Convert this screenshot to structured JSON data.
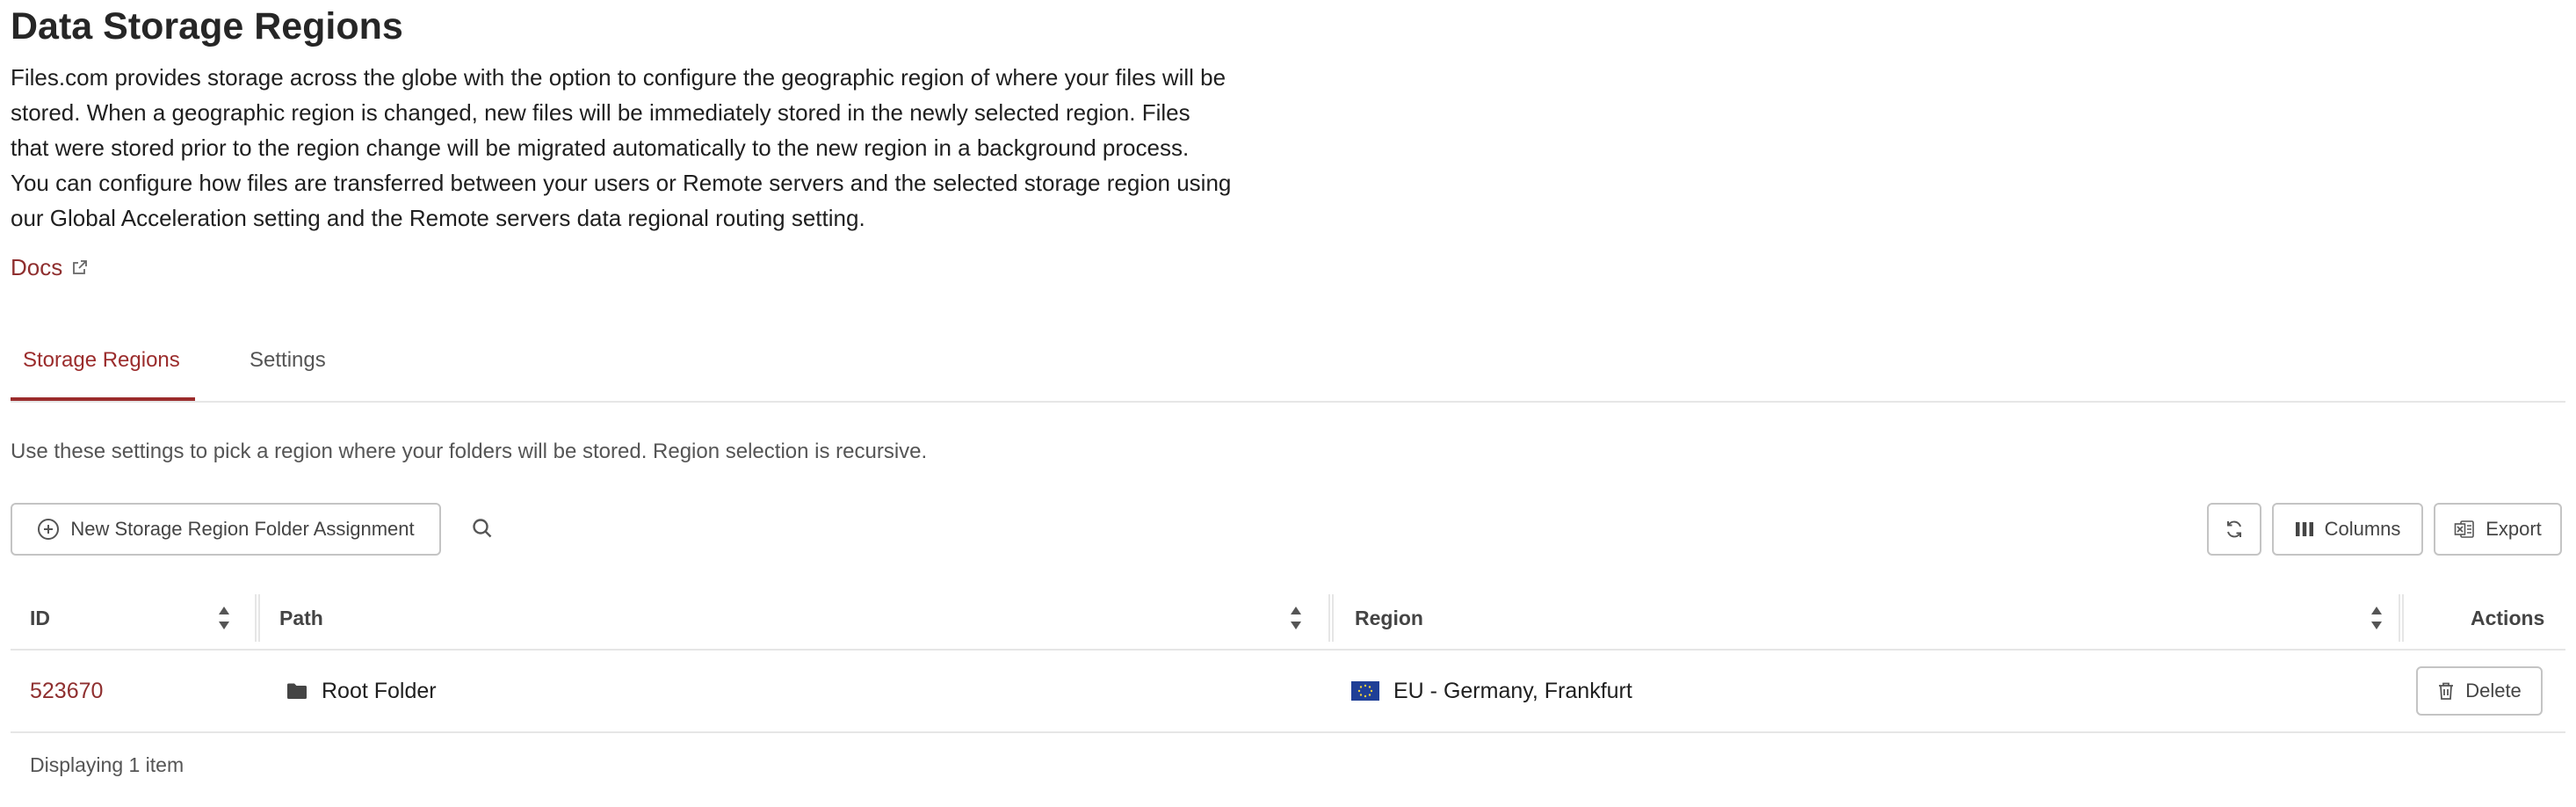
{
  "page": {
    "title": "Data Storage Regions",
    "description": "Files.com provides storage across the globe with the option to configure the geographic region of where your files will be stored. When a geographic region is changed, new files will be immediately stored in the newly selected region. Files that were stored prior to the region change will be migrated automatically to the new region in a background process. You can configure how files are transferred between your users or Remote servers and the selected storage region using our Global Acceleration setting and the Remote servers data regional routing setting.",
    "docs_label": "Docs"
  },
  "tabs": [
    {
      "label": "Storage Regions",
      "active": true
    },
    {
      "label": "Settings",
      "active": false
    }
  ],
  "hint": "Use these settings to pick a region where your folders will be stored. Region selection is recursive.",
  "toolbar": {
    "new_label": "New Storage Region Folder Assignment",
    "columns_label": "Columns",
    "export_label": "Export"
  },
  "table": {
    "columns": [
      "ID",
      "Path",
      "Region",
      "Actions"
    ],
    "rows": [
      {
        "id": "523670",
        "path": "Root Folder",
        "region": "EU - Germany, Frankfurt",
        "action_label": "Delete"
      }
    ],
    "footer": "Displaying 1 item"
  },
  "colors": {
    "accent": "#9b2c2c",
    "link": "#8f2f2f",
    "border": "#c4c4c4",
    "eu_flag_blue": "#1f3f96",
    "eu_flag_stars": "#f3d23b"
  },
  "icons": [
    "external-link-icon",
    "plus-circle-icon",
    "search-icon",
    "refresh-icon",
    "columns-icon",
    "excel-icon",
    "sort-icon",
    "folder-icon",
    "eu-flag-icon",
    "trash-icon"
  ]
}
